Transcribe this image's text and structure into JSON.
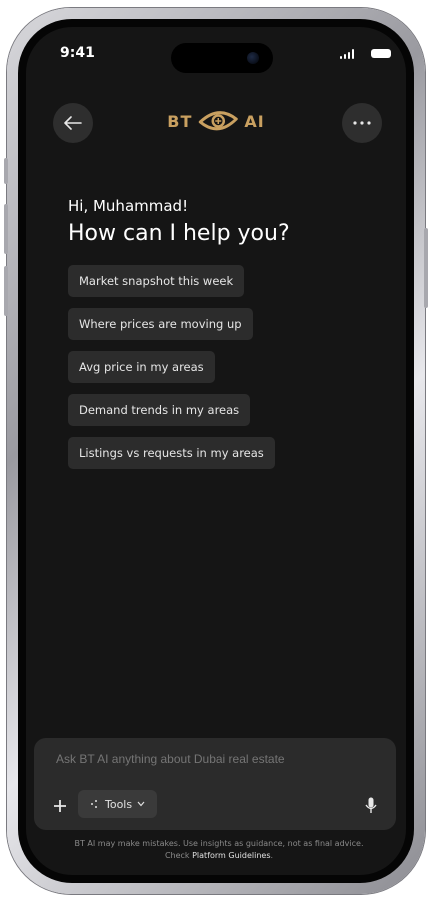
{
  "status_bar": {
    "time": "9:41"
  },
  "header": {
    "back_icon": "arrow-left-icon",
    "logo_left": "BT",
    "logo_right": "AI",
    "logo_icon": "eye-logo-icon",
    "more_icon": "ellipsis-icon"
  },
  "greeting": "Hi, Muhammad!",
  "headline": "How can I help you?",
  "suggestions": [
    "Market snapshot this week",
    "Where prices are moving up",
    "Avg price in my areas",
    "Demand trends in my areas",
    "Listings vs requests in my areas"
  ],
  "composer": {
    "placeholder": "Ask BT AI anything about Dubai real estate",
    "plus_icon": "plus-icon",
    "tools_label": "Tools",
    "tools_icon": "sparkle-icon",
    "mic_icon": "microphone-icon"
  },
  "disclaimer": {
    "line1": "BT AI may make mistakes. Use insights as guidance, not as final advice.",
    "line2_prefix": "Check",
    "link": "Platform Guidelines",
    "line2_suffix": "."
  },
  "colors": {
    "background": "#151515",
    "accent_gold": "#c9a060",
    "chip_bg": "#2c2c2c",
    "composer_bg": "#2b2b2b"
  }
}
